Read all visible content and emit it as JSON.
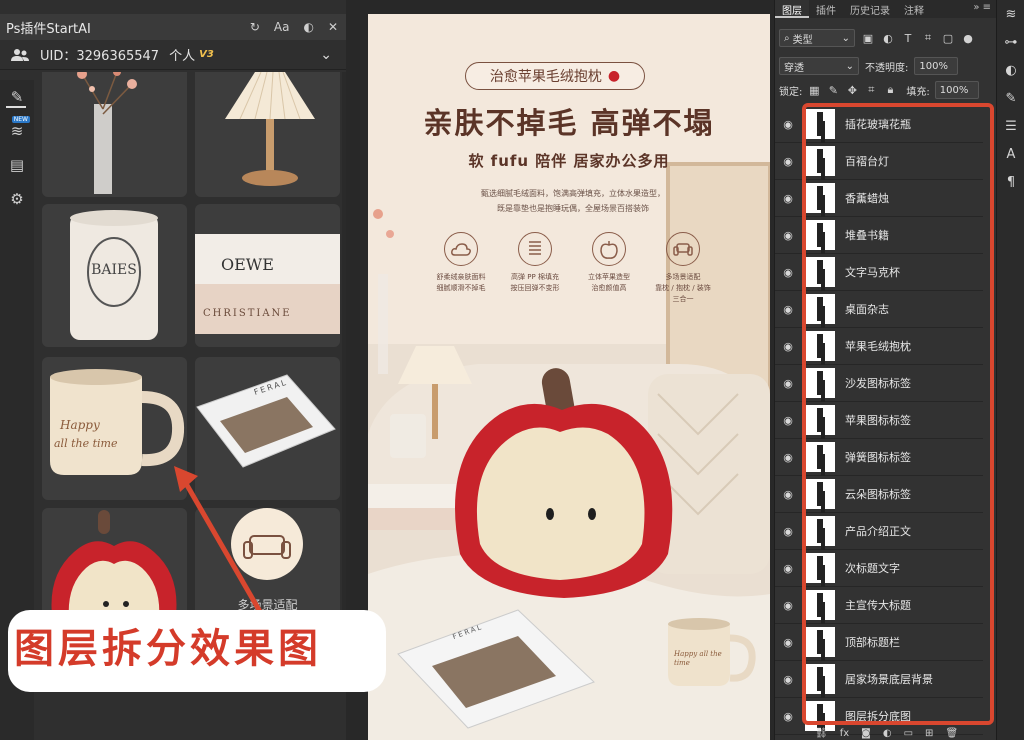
{
  "plugin": {
    "title": "Ps插件StartAI",
    "font_tool": "Aa",
    "uid": "UID：3296365547",
    "account": "个人",
    "tier": "V3",
    "new_badge": "NEW"
  },
  "grid_items": {
    "sofa_label": "多场景适配",
    "mug_text_line1": "Happy",
    "mug_text_line2": "all the time",
    "candle_text": "BAIES",
    "book_title": "OEWE",
    "book_sub": "CHRISTIANE",
    "magazine": "FERAL"
  },
  "poster": {
    "pill": "治愈苹果毛绒抱枕",
    "headline": "亲肤不掉毛  高弹不塌",
    "subheadline": "软 fufu 陪伴 居家办公多用",
    "desc_line1": "甄选细腻毛绒面料，饱满高弹填充，立体水果造型，",
    "desc_line2": "既是靠垫也是抱睡玩偶，全屋场景百搭装饰",
    "features": [
      {
        "line1": "舒柔绒亲肤面料",
        "line2": "细腻顺滑不掉毛"
      },
      {
        "line1": "高弹 PP 棉填充",
        "line2": "按压回弹不变形"
      },
      {
        "line1": "立体苹果造型",
        "line2": "治愈颜值高"
      },
      {
        "line1": "多场景适配",
        "line2": "靠枕 / 抱枕 / 装饰",
        "line3": "三合一"
      }
    ],
    "magazine": "FERAL",
    "mug_text": "Happy all the time"
  },
  "caption": "图层拆分效果图",
  "layers_panel": {
    "tabs": [
      "图层",
      "插件",
      "历史记录",
      "注释"
    ],
    "filter_label": "类型",
    "blend_mode": "穿透",
    "opacity_label": "不透明度:",
    "opacity_value": "100%",
    "lock_label": "锁定:",
    "fill_label": "填充:",
    "fill_value": "100%",
    "layers": [
      "插花玻璃花瓶",
      "百褶台灯",
      "香薰蜡烛",
      "堆叠书籍",
      "文字马克杯",
      "桌面杂志",
      "苹果毛绒抱枕",
      "沙发图标标签",
      "苹果图标标签",
      "弹簧图标标签",
      "云朵图标标签",
      "产品介绍正文",
      "次标题文字",
      "主宣传大标题",
      "顶部标题栏",
      "居家场景底层背景",
      "图层拆分底图"
    ]
  },
  "colors": {
    "accent_red": "#d9472f",
    "poster_brown": "#5b3427",
    "apple_red": "#c8232b"
  }
}
